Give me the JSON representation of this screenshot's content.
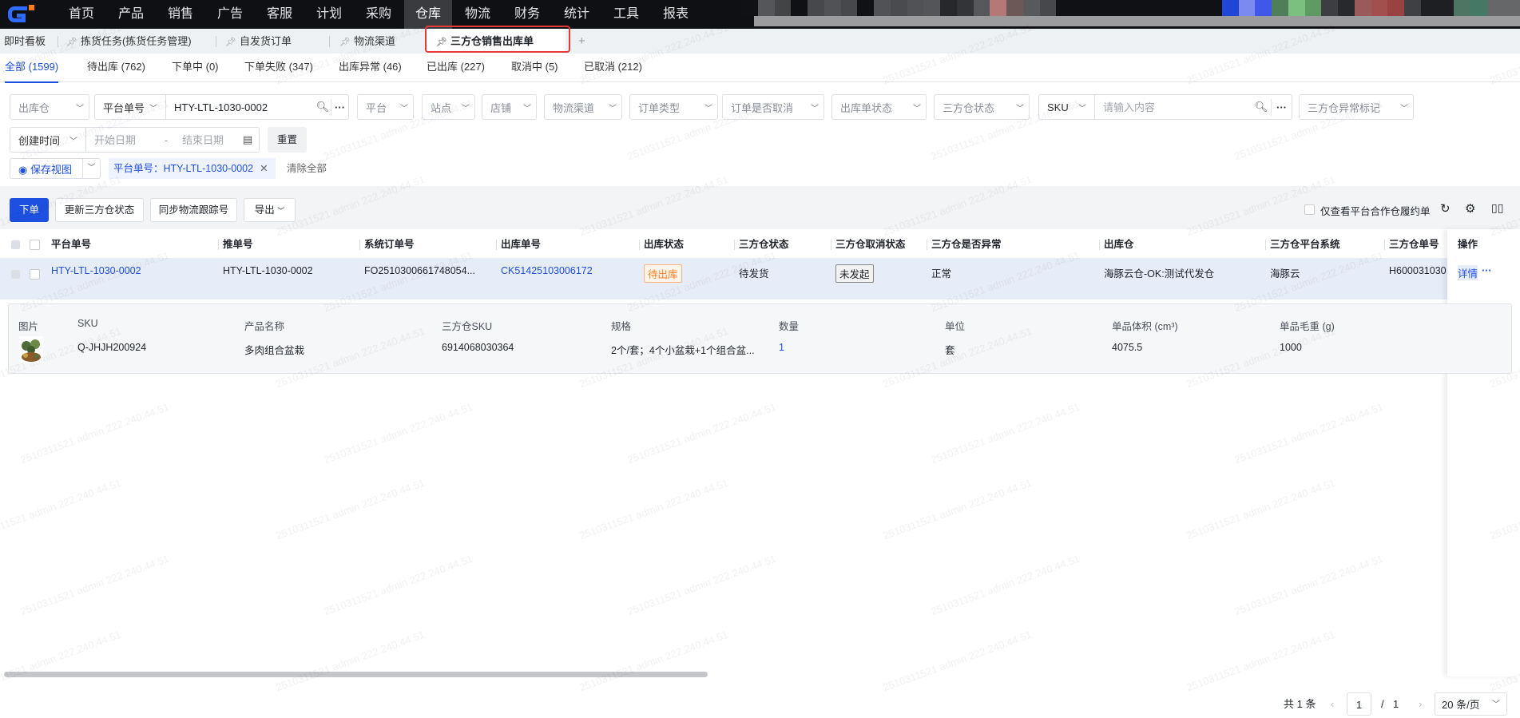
{
  "nav": {
    "items": [
      "首页",
      "产品",
      "销售",
      "广告",
      "客服",
      "计划",
      "采购",
      "仓库",
      "物流",
      "财务",
      "统计",
      "工具",
      "报表"
    ],
    "active": "仓库",
    "blur_colors": [
      "#101114",
      "#55565a",
      "#434446",
      "#101114",
      "#47484b",
      "#515255",
      "#47484b",
      "#101114",
      "#515255",
      "#4a4b4e",
      "#515255",
      "#545557",
      "#27282b",
      "#333437",
      "#56575a",
      "#b57878",
      "#6d5858",
      "#58595c",
      "#47484b",
      "#101114",
      "#101114",
      "#101114",
      "#101114",
      "#101114",
      "#101114",
      "#101114",
      "#101114",
      "#101114",
      "#101114",
      "#2046d6",
      "#7a8af0",
      "#4058e8",
      "#4f7f58",
      "#7cc07f",
      "#5f9a64",
      "#3d3e41",
      "#28292c",
      "#9a5a5a",
      "#a34f4f",
      "#9a4141",
      "#3f4043",
      "#1e1f22",
      "#1e1f22",
      "#4e7563",
      "#467866",
      "#666769",
      "#666769"
    ]
  },
  "page_tabs": [
    {
      "label": "即时看板",
      "pinned": false
    },
    {
      "label": "拣货任务(拣货任务管理)",
      "pinned": true
    },
    {
      "label": "自发货订单",
      "pinned": true
    },
    {
      "label": "物流渠道",
      "pinned": true
    },
    {
      "label": "三方仓销售出库单",
      "pinned": true,
      "active": true
    }
  ],
  "add_tab": "+",
  "status_tabs": [
    "全部 (1599)",
    "待出库 (762)",
    "下单中 (0)",
    "下单失败 (347)",
    "出库异常 (46)",
    "已出库 (227)",
    "取消中 (5)",
    "已取消 (212)"
  ],
  "filters": {
    "warehouse": "出库仓",
    "platform_no_type": "平台单号",
    "platform_no_value": "HTY-LTL-1030-0002",
    "platform": "平台",
    "site": "站点",
    "store": "店铺",
    "channel": "物流渠道",
    "order_type": "订单类型",
    "order_cancelled": "订单是否取消",
    "outbound_status": "出库单状态",
    "tpw_status": "三方仓状态",
    "sku_type": "SKU",
    "sku_placeholder": "请输入内容",
    "tpw_exception": "三方仓异常标记",
    "date_type": "创建时间",
    "start_placeholder": "开始日期",
    "date_sep": "-",
    "end_placeholder": "结束日期",
    "reset": "重置",
    "save_view": "保存视图",
    "chip": "平台单号：HTY-LTL-1030-0002",
    "clear_all": "清除全部"
  },
  "toolbar": {
    "place_order": "下单",
    "update_status": "更新三方仓状态",
    "sync_tracking": "同步物流跟踪号",
    "export": "导出",
    "only_platform": "仅查看平台合作仓履约单"
  },
  "table": {
    "headers": [
      "平台单号",
      "推单号",
      "系统订单号",
      "出库单号",
      "出库状态",
      "三方仓状态",
      "三方仓取消状态",
      "三方仓是否异常",
      "出库仓",
      "三方仓平台系统",
      "三方仓单号",
      "操作"
    ],
    "row": {
      "platform_no": "HTY-LTL-1030-0002",
      "push_no": "HTY-LTL-1030-0002",
      "system_no": "FO2510300661748054...",
      "outbound_no": "CK51425103006172",
      "outbound_status": "待出库",
      "tpw_status": "待发货",
      "cancel_status": "未发起",
      "exception": "正常",
      "warehouse": "海豚云仓-OK:测试代发仓",
      "platform_system": "海豚云",
      "tpw_no": "H600031030",
      "detail": "详情",
      "more": "···"
    },
    "sub_headers": [
      "图片",
      "SKU",
      "产品名称",
      "三方仓SKU",
      "规格",
      "数量",
      "单位",
      "单品体积 (cm³)",
      "单品毛重 (g)"
    ],
    "sub_row": {
      "sku": "Q-JHJH200924",
      "name": "多肉组合盆栽",
      "tpw_sku": "6914068030364",
      "spec": "2个/套；4个小盆栽+1个组合盆...",
      "qty": "1",
      "unit": "套",
      "volume": "4075.5",
      "weight": "1000"
    }
  },
  "pager": {
    "total": "共 1 条",
    "page": "1",
    "sep": "/",
    "pages": "1",
    "size": "20 条/页"
  },
  "watermark": "2510311521 admin 222.240.44.51"
}
